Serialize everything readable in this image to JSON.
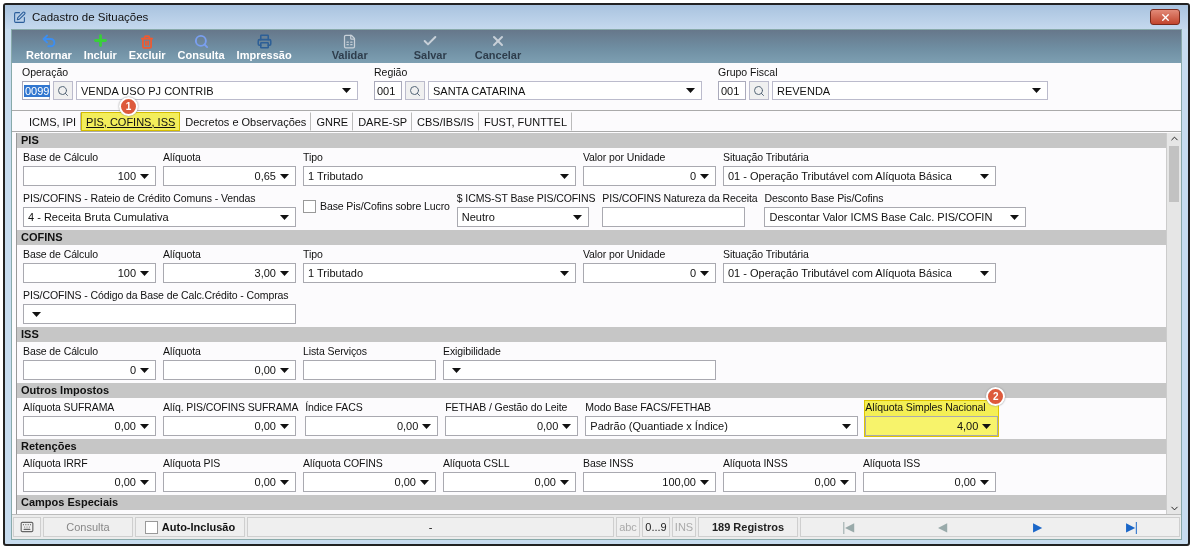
{
  "window": {
    "title": "Cadastro de Situações"
  },
  "toolbar": [
    {
      "label": "Retornar",
      "disabled": false
    },
    {
      "label": "Incluir",
      "disabled": false
    },
    {
      "label": "Excluir",
      "disabled": false
    },
    {
      "label": "Consulta",
      "disabled": false
    },
    {
      "label": "Impressão",
      "disabled": false
    },
    {
      "label": "Validar",
      "disabled": true
    },
    {
      "label": "Salvar",
      "disabled": true
    },
    {
      "label": "Cancelar",
      "disabled": true
    }
  ],
  "header": [
    {
      "label": "Operação",
      "code": "0099",
      "code_selected": true,
      "value": "VENDA USO PJ CONTRIB"
    },
    {
      "label": "Região",
      "code": "001",
      "code_selected": false,
      "value": "SANTA CATARINA"
    },
    {
      "label": "Grupo Fiscal",
      "code": "001",
      "code_selected": false,
      "value": "REVENDA"
    }
  ],
  "tabs": [
    {
      "label": "ICMS, IPI",
      "selected": false,
      "highlighted": false
    },
    {
      "label": "PIS, COFINS, ISS",
      "selected": true,
      "highlighted": true,
      "badge": "1"
    },
    {
      "label": "Decretos e Observações",
      "selected": false,
      "highlighted": false
    },
    {
      "label": "GNRE",
      "selected": false,
      "highlighted": false
    },
    {
      "label": "DARE-SP",
      "selected": false,
      "highlighted": false
    },
    {
      "label": "CBS/IBS/IS",
      "selected": false,
      "highlighted": false
    },
    {
      "label": "FUST, FUNTTEL",
      "selected": false,
      "highlighted": false
    }
  ],
  "sections": [
    {
      "title": "PIS",
      "fields": [
        {
          "kind": "number",
          "label": "Base de Cálculo",
          "value": "100",
          "highlighted": false
        },
        {
          "kind": "number",
          "label": "Alíquota",
          "value": "0,65",
          "highlighted": false
        },
        {
          "kind": "select",
          "label": "Tipo",
          "value": "1 Tributado",
          "highlighted": false
        },
        {
          "kind": "number",
          "label": "Valor por Unidade",
          "value": "0",
          "highlighted": false
        },
        {
          "kind": "select",
          "label": "Situação Tributária",
          "value": "01 - Operação Tributável com Alíquota Básica",
          "highlighted": false
        }
      ],
      "more_fields": [
        {
          "kind": "select",
          "label": "PIS/COFINS - Rateio de Crédito Comuns - Vendas",
          "value": "4 - Receita Bruta Cumulativa",
          "highlighted": false
        },
        {
          "kind": "checkbox",
          "label": "Base Pis/Cofins sobre Lucro",
          "checked": false,
          "highlighted": false
        },
        {
          "kind": "short-select",
          "label": "$ ICMS-ST Base PIS/COFINS",
          "value": "Neutro",
          "highlighted": false
        },
        {
          "kind": "text",
          "label": "PIS/COFINS Natureza da Receita",
          "highlighted": false
        },
        {
          "kind": "medium-select",
          "label": "Desconto Base Pis/Cofins",
          "value": "Descontar Valor ICMS Base Calc. PIS/COFIN",
          "highlighted": false
        }
      ]
    },
    {
      "title": "COFINS",
      "fields": [
        {
          "kind": "number",
          "label": "Base de Cálculo",
          "value": "100",
          "highlighted": false
        },
        {
          "kind": "number",
          "label": "Alíquota",
          "value": "3,00",
          "highlighted": false
        },
        {
          "kind": "select",
          "label": "Tipo",
          "value": "1 Tributado",
          "highlighted": false
        },
        {
          "kind": "number",
          "label": "Valor por Unidade",
          "value": "0",
          "highlighted": false
        },
        {
          "kind": "select",
          "label": "Situação Tributária",
          "value": "01 - Operação Tributável com Alíquota Básica",
          "highlighted": false
        }
      ],
      "more_fields": [
        {
          "kind": "select",
          "label": "PIS/COFINS - Código da Base de Calc.Crédito - Compras",
          "highlighted": false
        }
      ]
    },
    {
      "title": "ISS",
      "fields": [
        {
          "kind": "number",
          "label": "Base de Cálculo",
          "value": "0",
          "highlighted": false
        },
        {
          "kind": "number",
          "label": "Alíquota",
          "value": "0,00",
          "highlighted": false
        },
        {
          "kind": "text",
          "label": "Lista Serviços",
          "highlighted": false
        },
        {
          "kind": "select",
          "label": "Exigibilidade",
          "highlighted": false
        }
      ]
    },
    {
      "title": "Outros Impostos",
      "fields": [
        {
          "kind": "number",
          "label": "Alíquota SUFRAMA",
          "value": "0,00",
          "highlighted": false
        },
        {
          "kind": "number",
          "label": "Alíq. PIS/COFINS SUFRAMA",
          "value": "0,00",
          "highlighted": false
        },
        {
          "kind": "number",
          "label": "Índice FACS",
          "value": "0,00",
          "highlighted": false
        },
        {
          "kind": "number",
          "label": "FETHAB / Gestão do Leite",
          "value": "0,00",
          "highlighted": false
        },
        {
          "kind": "select",
          "label": "Modo Base FACS/FETHAB",
          "value": "Padrão (Quantiade x Índice)",
          "highlighted": false
        },
        {
          "kind": "number",
          "label": "Alíquota Simples Nacional",
          "value": "4,00",
          "highlighted": true,
          "badge": "2"
        }
      ]
    },
    {
      "title": "Retenções",
      "fields": [
        {
          "kind": "number",
          "label": "Alíquota IRRF",
          "value": "0,00",
          "highlighted": false
        },
        {
          "kind": "number",
          "label": "Alíquota PIS",
          "value": "0,00",
          "highlighted": false
        },
        {
          "kind": "number",
          "label": "Alíquota COFINS",
          "value": "0,00",
          "highlighted": false
        },
        {
          "kind": "number",
          "label": "Alíquota CSLL",
          "value": "0,00",
          "highlighted": false
        },
        {
          "kind": "number",
          "label": "Base INSS",
          "value": "100,00",
          "highlighted": false
        },
        {
          "kind": "number",
          "label": "Alíquota INSS",
          "value": "0,00",
          "highlighted": false
        },
        {
          "kind": "number",
          "label": "Alíquota ISS",
          "value": "0,00",
          "highlighted": false
        }
      ]
    },
    {
      "title": "Campos Especiais"
    }
  ],
  "status_bar": {
    "mode": "Consulta",
    "auto_inclusion": {
      "label": "Auto-Inclusão",
      "checked": false
    },
    "message": "-",
    "indicators": [
      {
        "label": "abc",
        "on": false
      },
      {
        "label": "0...9",
        "on": true
      },
      {
        "label": "INS",
        "on": false
      }
    ],
    "records": "189 Registros",
    "nav": [
      {
        "label": "|◀",
        "disabled": true
      },
      {
        "label": "◀",
        "disabled": true
      },
      {
        "label": "▶",
        "disabled": false
      },
      {
        "label": "▶|",
        "disabled": false
      }
    ]
  }
}
